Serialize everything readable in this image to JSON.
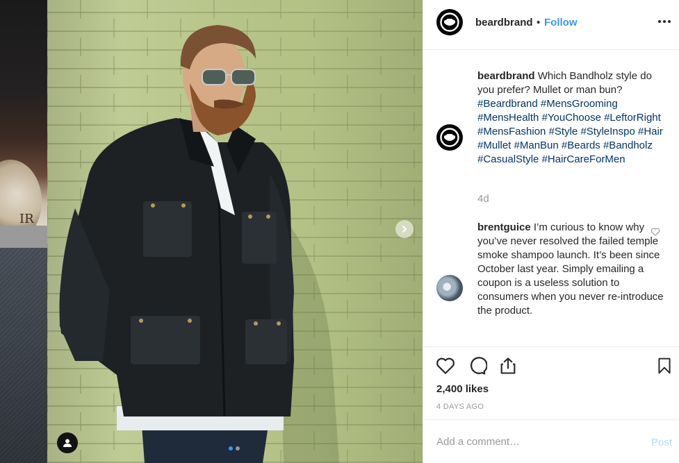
{
  "post": {
    "username": "beardbrand",
    "separator": "•",
    "follow_label": "Follow",
    "caption_text": "Which Bandholz style do you prefer? Mullet or man bun?",
    "hashtags": [
      "#Beardbrand",
      "#MensGrooming",
      "#MensHealth",
      "#YouChoose",
      "#LeftorRight",
      "#MensFashion",
      "#Style",
      "#StyleInspo",
      "#Hair",
      "#Mullet",
      "#ManBun",
      "#Beards",
      "#Bandholz",
      "#CasualStyle",
      "#HairCareForMen"
    ],
    "caption_age": "4d"
  },
  "comment": {
    "username": "brentguice",
    "text": "I’m curious to know why you’ve never resolved the failed temple smoke shampoo launch. It’s been since October last year. Simply emailing a coupon is a useless solution to consumers when you never re-introduce the product."
  },
  "actions": {
    "likes": "2,400 likes",
    "date": "4 DAYS AGO"
  },
  "add_comment": {
    "placeholder": "Add a comment…",
    "post_label": "Post"
  },
  "carousel": {
    "slides": 2,
    "active": 0
  },
  "background": {
    "label_fragment": "IR"
  },
  "icons": {
    "logo": "beardbrand-logo-icon",
    "more": "more-options-icon",
    "next": "chevron-right-icon",
    "tag": "user-tag-icon",
    "like": "heart-icon",
    "comment": "comment-icon",
    "share": "share-icon",
    "save": "bookmark-icon"
  },
  "colors": {
    "link": "#3897f0",
    "hashtag": "#003569",
    "muted": "#999999",
    "post_disabled": "#b2dffc"
  }
}
